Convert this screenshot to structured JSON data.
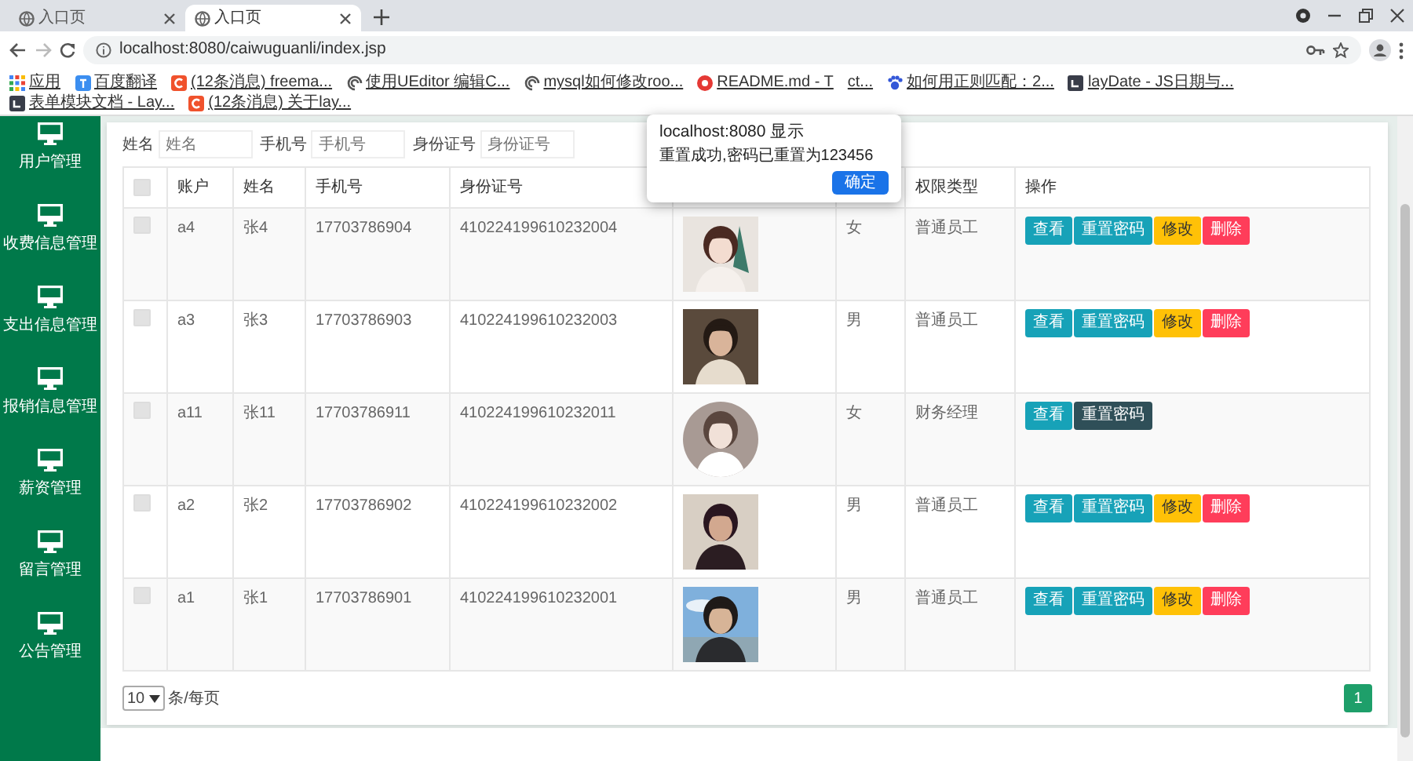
{
  "browser": {
    "tabs": [
      {
        "title": "入口页",
        "selected": false
      },
      {
        "title": "入口页",
        "selected": true
      }
    ],
    "url": "localhost:8080/caiwuguanli/index.jsp",
    "bookmarks": [
      "应用",
      "百度翻译",
      "(12条消息) freema...",
      "使用UEditor 编辑C...",
      "mysql如何修改roo...",
      "README.md - T",
      "ct...",
      "如何用正则匹配：2...",
      "layDate - JS日期与...",
      "表单模块文档 - Lay...",
      "(12条消息) 关于lay..."
    ]
  },
  "sidebar": {
    "items": [
      {
        "label": "用户管理"
      },
      {
        "label": "收费信息管理"
      },
      {
        "label": "支出信息管理"
      },
      {
        "label": "报销信息管理"
      },
      {
        "label": "薪资管理"
      },
      {
        "label": "留言管理"
      },
      {
        "label": "公告管理"
      }
    ]
  },
  "filters": [
    {
      "label": "姓名",
      "placeholder": "姓名"
    },
    {
      "label": "手机号",
      "placeholder": "手机号"
    },
    {
      "label": "身份证号",
      "placeholder": "身份证号"
    }
  ],
  "table": {
    "header_checkbox": {
      "checked": false
    },
    "columns": [
      "账户",
      "姓名",
      "手机号",
      "身份证号",
      "权限类型",
      "操作"
    ],
    "rows": [
      {
        "checked": false,
        "account": "a4",
        "name": "张4",
        "phone": "17703786904",
        "id_number": "410224199610232004",
        "avatar": {
          "kind": "picture"
        },
        "gender": "女",
        "role": "普通员工",
        "actions": [
          {
            "label": "查看",
            "kind": "view",
            "pressed": false
          },
          {
            "label": "重置密码",
            "kind": "reset",
            "pressed": false
          },
          {
            "label": "修改",
            "kind": "edit",
            "pressed": false
          },
          {
            "label": "删除",
            "kind": "delete",
            "pressed": false
          }
        ]
      },
      {
        "checked": false,
        "account": "a3",
        "name": "张3",
        "phone": "17703786903",
        "id_number": "410224199610232003",
        "avatar": {
          "kind": "picture"
        },
        "gender": "男",
        "role": "普通员工",
        "actions": [
          {
            "label": "查看",
            "kind": "view",
            "pressed": false
          },
          {
            "label": "重置密码",
            "kind": "reset",
            "pressed": false
          },
          {
            "label": "修改",
            "kind": "edit",
            "pressed": false
          },
          {
            "label": "删除",
            "kind": "delete",
            "pressed": false
          }
        ]
      },
      {
        "checked": false,
        "account": "a11",
        "name": "张11",
        "phone": "17703786911",
        "id_number": "410224199610232011",
        "avatar": {
          "kind": "picture"
        },
        "gender": "女",
        "role": "财务经理",
        "actions": [
          {
            "label": "查看",
            "kind": "view",
            "pressed": false
          },
          {
            "label": "重置密码",
            "kind": "reset",
            "pressed": true
          }
        ]
      },
      {
        "checked": false,
        "account": "a2",
        "name": "张2",
        "phone": "17703786902",
        "id_number": "410224199610232002",
        "avatar": {
          "kind": "picture"
        },
        "gender": "男",
        "role": "普通员工",
        "actions": [
          {
            "label": "查看",
            "kind": "view",
            "pressed": false
          },
          {
            "label": "重置密码",
            "kind": "reset",
            "pressed": false
          },
          {
            "label": "修改",
            "kind": "edit",
            "pressed": false
          },
          {
            "label": "删除",
            "kind": "delete",
            "pressed": false
          }
        ]
      },
      {
        "checked": false,
        "account": "a1",
        "name": "张1",
        "phone": "17703786901",
        "id_number": "410224199610232001",
        "avatar": {
          "kind": "picture"
        },
        "gender": "男",
        "role": "普通员工",
        "actions": [
          {
            "label": "查看",
            "kind": "view",
            "pressed": false
          },
          {
            "label": "重置密码",
            "kind": "reset",
            "pressed": false
          },
          {
            "label": "修改",
            "kind": "edit",
            "pressed": false
          },
          {
            "label": "删除",
            "kind": "delete",
            "pressed": false
          }
        ]
      }
    ]
  },
  "pagination": {
    "page_size": "10",
    "page_size_label": "条/每页",
    "pages": [
      {
        "label": "1",
        "selected": true
      }
    ]
  },
  "dialog": {
    "title": "localhost:8080 显示",
    "message": "重置成功,密码已重置为123456",
    "button": "确定"
  }
}
